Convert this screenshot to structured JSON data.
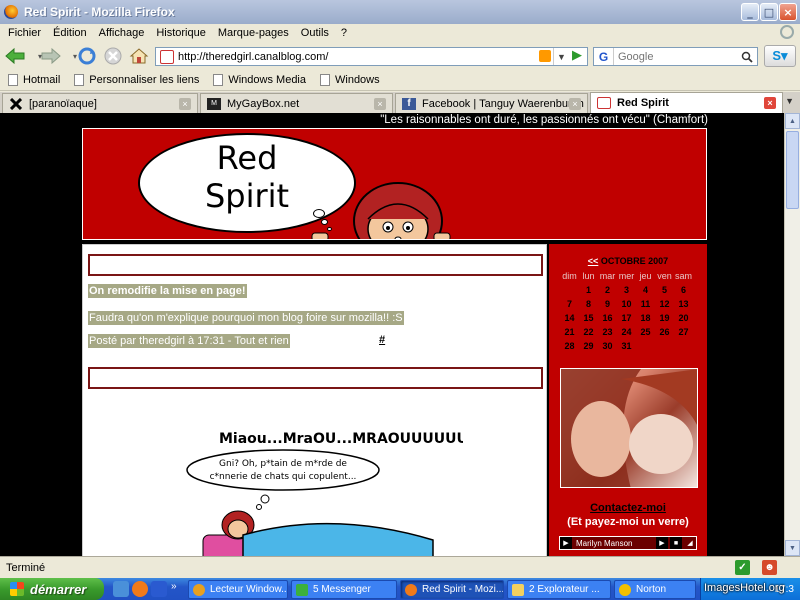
{
  "window": {
    "title": "Red Spirit - Mozilla Firefox",
    "controls": {
      "minimize": "_",
      "maximize": "□",
      "close": "×"
    }
  },
  "menu": [
    "Fichier",
    "Édition",
    "Affichage",
    "Historique",
    "Marque-pages",
    "Outils",
    "?"
  ],
  "nav": {
    "url": "http://theredgirl.canalblog.com/",
    "search_placeholder": "Google",
    "search_engine_letter": "G"
  },
  "bookmarks": [
    "Hotmail",
    "Personnaliser les liens",
    "Windows Media",
    "Windows"
  ],
  "tabs": [
    {
      "label": "[paranoïaque]",
      "active": false
    },
    {
      "label": "MyGayBox.net",
      "active": false
    },
    {
      "label": "Facebook | Tanguy Waerenburgh",
      "active": false
    },
    {
      "label": "Red Spirit",
      "active": true
    }
  ],
  "page": {
    "quote": "\"Les raisonnables ont duré, les passionnés ont vécu\" (Chamfort)",
    "header_title_line1": "Red",
    "header_title_line2": "Spirit",
    "post": {
      "title": "On remodifie la mise en page!",
      "body": "Faudra qu'on m'explique pourquoi mon blog foire sur mozilla!! :S",
      "meta": "Posté par theredgirl à 17:31 - Tout et rien",
      "permalink": "#"
    },
    "comic": {
      "heading": "Miaou...MraOU...MRAOUUUUUU",
      "bubble_line1": "Gni? Oh, p*tain de m*rde de",
      "bubble_line2": "c*nnerie de chats qui copulent..."
    },
    "sidebar": {
      "calendar": {
        "prev": "<<",
        "month": "OCTOBRE 2007",
        "days": [
          "dim",
          "lun",
          "mar",
          "mer",
          "jeu",
          "ven",
          "sam"
        ],
        "weeks": [
          [
            "",
            "1",
            "2",
            "3",
            "4",
            "5",
            "6"
          ],
          [
            "7",
            "8",
            "9",
            "10",
            "11",
            "12",
            "13"
          ],
          [
            "14",
            "15",
            "16",
            "17",
            "18",
            "19",
            "20"
          ],
          [
            "21",
            "22",
            "23",
            "24",
            "25",
            "26",
            "27"
          ],
          [
            "28",
            "29",
            "30",
            "31",
            "",
            "",
            ""
          ]
        ]
      },
      "contact": "Contactez-moi",
      "drinks": "(Et payez-moi un verre)",
      "player_text": "Marilyn Manson"
    }
  },
  "status": {
    "text": "Terminé"
  },
  "taskbar": {
    "start": "démarrer",
    "tasks": [
      {
        "label": "Lecteur Window..."
      },
      {
        "label": "5 Messenger"
      },
      {
        "label": "Red Spirit - Mozi..."
      },
      {
        "label": "2 Explorateur ..."
      },
      {
        "label": "Norton"
      }
    ],
    "clock": "17:3",
    "watermark": "ImagesHotel.org"
  },
  "colors": {
    "blog_red": "#c00000",
    "post_highlight": "#a6a885",
    "title_box_border": "#7a1515"
  }
}
